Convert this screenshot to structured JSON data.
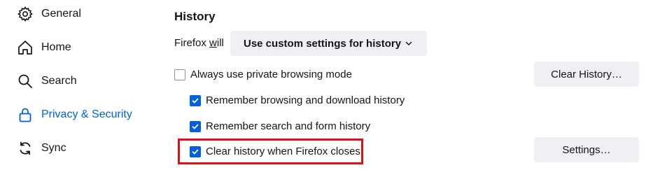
{
  "sidebar": {
    "items": [
      {
        "label": "General",
        "icon": "gear-icon"
      },
      {
        "label": "Home",
        "icon": "home-icon"
      },
      {
        "label": "Search",
        "icon": "search-icon"
      },
      {
        "label": "Privacy & Security",
        "icon": "lock-icon",
        "selected": true
      },
      {
        "label": "Sync",
        "icon": "sync-icon"
      }
    ]
  },
  "history": {
    "title": "History",
    "firefox_will_prefix": "Firefox ",
    "firefox_will_underlined": "w",
    "firefox_will_suffix": "ill",
    "mode_selected": "Use custom settings for history",
    "private_mode_label": "Always use private browsing mode",
    "remember_browsing_label": "Remember browsing and download history",
    "remember_search_label": "Remember search and form history",
    "clear_on_close_label": "Clear history when Firefox closes",
    "clear_history_button": "Clear History…",
    "settings_button": "Settings…"
  },
  "colors": {
    "accent": "#0061e0",
    "highlight": "#d4151c",
    "button_bg": "#f0f0f4"
  }
}
